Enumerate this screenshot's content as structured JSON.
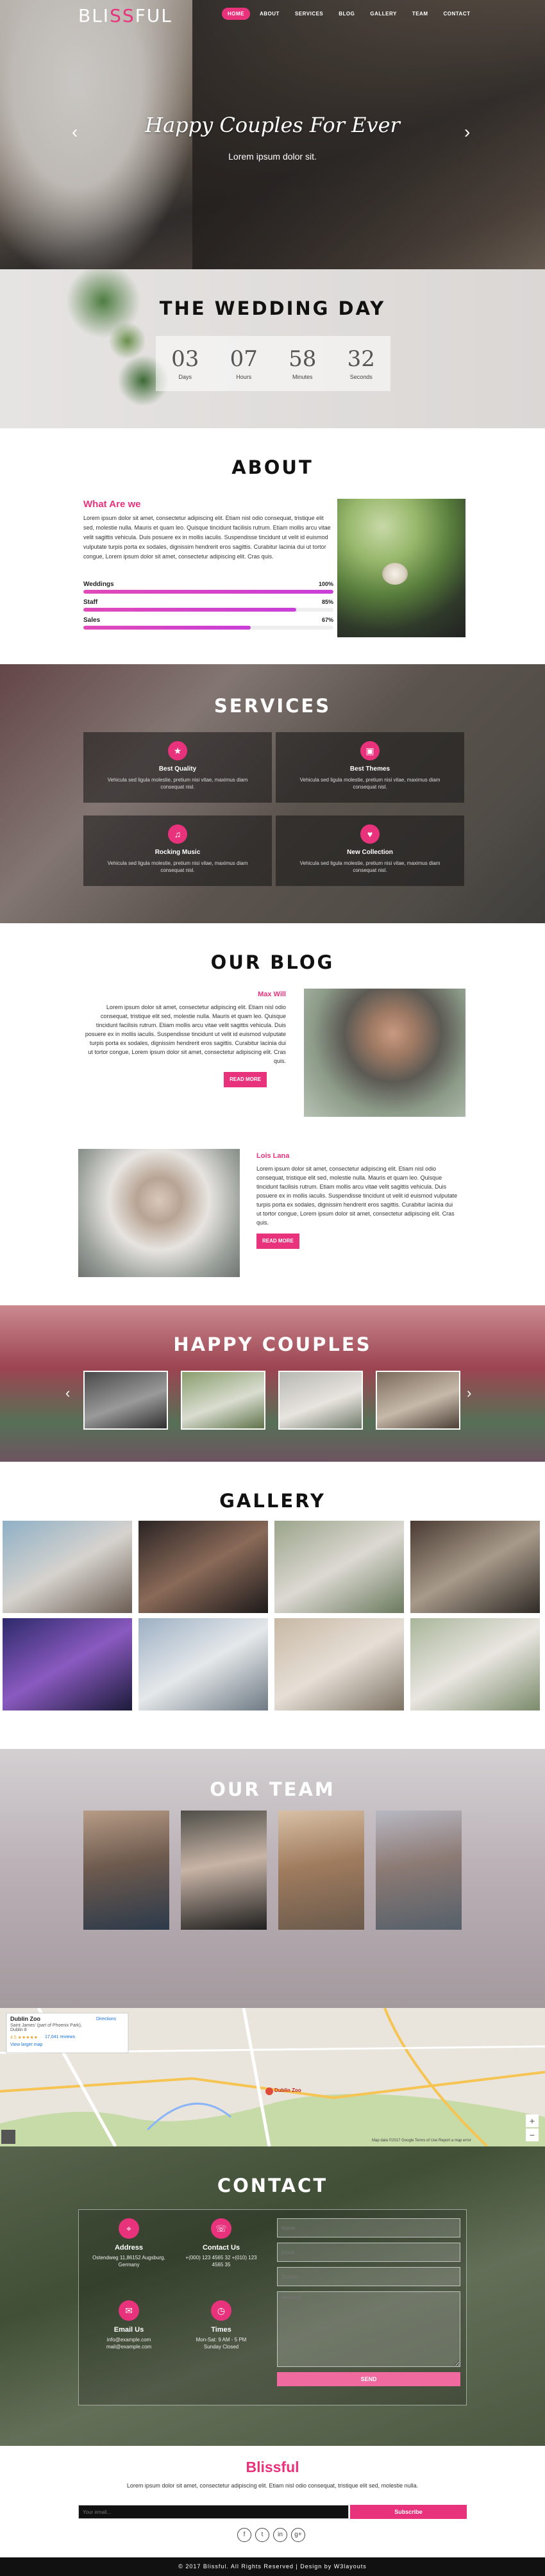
{
  "nav": {
    "logo_a": "BLI",
    "logo_b": "SS",
    "logo_c": "FUL",
    "items": [
      "HOME",
      "ABOUT",
      "SERVICES",
      "BLOG",
      "GALLERY",
      "TEAM",
      "CONTACT"
    ]
  },
  "banner": {
    "title": "Happy Couples For Ever",
    "subtitle": "Lorem ipsum dolor sit.",
    "prev": "‹",
    "next": "›"
  },
  "wedding_day": {
    "title": "THE WEDDING DAY",
    "counters": [
      {
        "value": "03",
        "label": "Days"
      },
      {
        "value": "07",
        "label": "Hours"
      },
      {
        "value": "58",
        "label": "Minutes"
      },
      {
        "value": "32",
        "label": "Seconds"
      }
    ]
  },
  "about": {
    "title": "ABOUT",
    "heading": "What Are we",
    "text": "Lorem ipsum dolor sit amet, consectetur adipiscing elit. Etiam nisl odio consequat, tristique elit sed, molestie nulla. Mauris et quam leo. Quisque tincidunt facilisis rutrum. Etiam mollis arcu vitae velit sagittis vehicula. Duis posuere ex in mollis iaculis. Suspendisse tincidunt ut velit id euismod vulputate turpis porta ex sodales, dignissim hendrerit eros sagittis. Curabitur lacinia dui ut tortor congue, Lorem ipsum dolor sit amet, consectetur adipiscing elit. Cras quis.",
    "bars": [
      {
        "label": "Weddings",
        "value": 100,
        "text": "100%"
      },
      {
        "label": "Staff",
        "value": 85,
        "text": "85%"
      },
      {
        "label": "Sales",
        "value": 67,
        "text": "67%"
      }
    ]
  },
  "services": {
    "title": "SERVICES",
    "items": [
      {
        "icon": "★",
        "name": "Best Quality",
        "desc": "Vehicula sed ligula molestie, pretium nisi vitae, maximus diam consequat nisl."
      },
      {
        "icon": "▣",
        "name": "Best Themes",
        "desc": "Vehicula sed ligula molestie, pretium nisi vitae, maximus diam consequat nisl."
      },
      {
        "icon": "♫",
        "name": "Rocking Music",
        "desc": "Vehicula sed ligula molestie, pretium nisi vitae, maximus diam consequat nisl."
      },
      {
        "icon": "♥",
        "name": "New Collection",
        "desc": "Vehicula sed ligula molestie, pretium nisi vitae, maximus diam consequat nisl."
      }
    ]
  },
  "blog": {
    "title": "OUR BLOG",
    "posts": [
      {
        "author": "Max Will",
        "text": "Lorem ipsum dolor sit amet, consectetur adipiscing elit. Etiam nisl odio consequat, tristique elit sed, molestie nulla. Mauris et quam leo. Quisque tincidunt facilisis rutrum. Etiam mollis arcu vitae velit sagittis vehicula. Duis posuere ex in mollis iaculis. Suspendisse tincidunt ut velit id euismod vulputate turpis porta ex sodales, dignissim hendrerit eros sagittis. Curabitur lacinia dui ut tortor congue, Lorem ipsum dolor sit amet, consectetur adipiscing elit. Cras quis.",
        "button": "READ MORE"
      },
      {
        "author": "Lois Lana",
        "text": "Lorem ipsum dolor sit amet, consectetur adipiscing elit. Etiam nisl odio consequat, tristique elit sed, molestie nulla. Mauris et quam leo. Quisque tincidunt facilisis rutrum. Etiam mollis arcu vitae velit sagittis vehicula. Duis posuere ex in mollis iaculis. Suspendisse tincidunt ut velit id euismod vulputate turpis porta ex sodales, dignissim hendrerit eros sagittis. Curabitur lacinia dui ut tortor congue, Lorem ipsum dolor sit amet, consectetur adipiscing elit. Cras quis.",
        "button": "READ MORE"
      }
    ]
  },
  "couples": {
    "title": "HAPPY COUPLES",
    "prev": "‹",
    "next": "›"
  },
  "gallery": {
    "title": "GALLERY"
  },
  "team": {
    "title": "OUR TEAM"
  },
  "map": {
    "place": "Dublin Zoo",
    "address": "Saint James' (part of Phoenix Park), Dublin 8",
    "rating": "4.5 ★★★★★",
    "reviews": "17,041 reviews",
    "larger": "View larger map",
    "directions": "Directions",
    "marker": "Dublin Zoo",
    "footer": "Map data ©2017 Google  Terms of Use  Report a map error",
    "zoom_in": "+",
    "zoom_out": "−"
  },
  "contact": {
    "title": "CONTACT",
    "items": [
      {
        "icon": "⌖",
        "title": "Address",
        "desc": "Ostendweg 11,86152 Augsburg, Germany"
      },
      {
        "icon": "☏",
        "title": "Contact Us",
        "desc": "+(000) 123 4565 32 +(010) 123 4565 35"
      },
      {
        "icon": "✉",
        "title": "Email Us",
        "desc": "info@example.com\nmail@example.com"
      },
      {
        "icon": "◷",
        "title": "Times",
        "desc": "Mon-Sat: 9 AM - 5 PM\nSunday Closed"
      }
    ],
    "placeholders": {
      "name": "Name",
      "email": "Email",
      "subject": "Subject",
      "message": "Message"
    },
    "send": "SEND"
  },
  "footer": {
    "logo": "Blissful",
    "text": "Lorem ipsum dolor sit amet, consectetur adipiscing elit. Etiam nisl odio consequat, tristique elit sed, molestie nulla.",
    "newsletter_placeholder": "Your email...",
    "subscribe": "Subscribe",
    "social": [
      "f",
      "t",
      "in",
      "g+"
    ],
    "copyright": "© 2017 Blissful. All Rights Reserved | Design by W3layouts"
  }
}
